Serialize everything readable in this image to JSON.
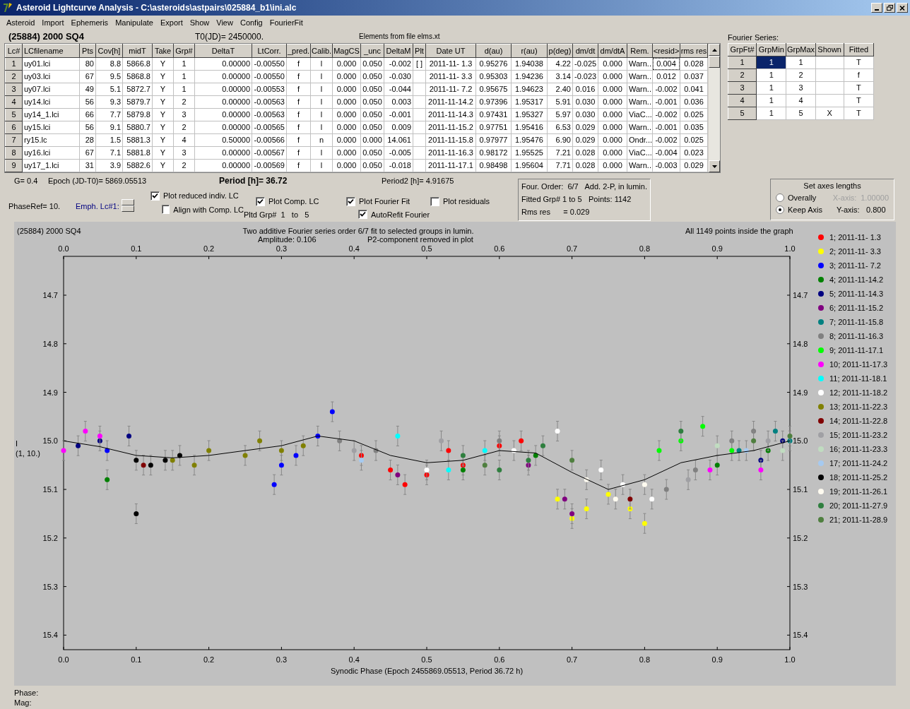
{
  "window": {
    "title": "Asteroid Lightcurve Analysis - C:\\asteroids\\astpairs\\025884_b1\\ini.alc"
  },
  "menu": [
    "Asteroid",
    "Import",
    "Ephemeris",
    "Manipulate",
    "Export",
    "Show",
    "View",
    "Config",
    "FourierFit"
  ],
  "object_name": "(25884) 2000 SQ4",
  "t0": "T0(JD)= 2450000.",
  "elements_note": "Elements from file elms.xt",
  "lc_table": {
    "columns": [
      "Lc#",
      "LCfilename",
      "Pts",
      "Cov[h]",
      "midT",
      "Take",
      "Grp#",
      "DeltaT",
      "LtCorr.",
      "_pred.",
      "Calib.",
      "MagCS",
      "_unc",
      "DeltaM",
      "Plt",
      "Date UT",
      "d(au)",
      "r(au)",
      "p(deg)",
      "dm/dt",
      "dm/dtA",
      "Rem.",
      "<resid>",
      "rms res"
    ],
    "rows": [
      {
        "focused": true,
        "cells": [
          "1",
          "uy01.lci",
          "80",
          "8.8",
          "5866.8",
          "Y",
          "1",
          "0.00000",
          "-0.00550",
          "f",
          "l",
          "0.000",
          "0.050",
          "-0.002",
          "[ ]",
          "2011-11- 1.3",
          "0.95276",
          "1.94038",
          "4.22",
          "-0.025",
          "0.000",
          "Warn..",
          "0.004",
          "0.028"
        ]
      },
      {
        "focused": false,
        "cells": [
          "2",
          "uy03.lci",
          "67",
          "9.5",
          "5868.8",
          "Y",
          "1",
          "0.00000",
          "-0.00550",
          "f",
          "l",
          "0.000",
          "0.050",
          "-0.030",
          null,
          "2011-11- 3.3",
          "0.95303",
          "1.94236",
          "3.14",
          "-0.023",
          "0.000",
          "Warn..",
          "0.012",
          "0.037"
        ]
      },
      {
        "focused": false,
        "cells": [
          "3",
          "uy07.lci",
          "49",
          "5.1",
          "5872.7",
          "Y",
          "1",
          "0.00000",
          "-0.00553",
          "f",
          "l",
          "0.000",
          "0.050",
          "-0.044",
          null,
          "2011-11- 7.2",
          "0.95675",
          "1.94623",
          "2.40",
          "0.016",
          "0.000",
          "Warn..",
          "-0.002",
          "0.041"
        ]
      },
      {
        "focused": false,
        "cells": [
          "4",
          "uy14.lci",
          "56",
          "9.3",
          "5879.7",
          "Y",
          "2",
          "0.00000",
          "-0.00563",
          "f",
          "l",
          "0.000",
          "0.050",
          "0.003",
          null,
          "2011-11-14.2",
          "0.97396",
          "1.95317",
          "5.91",
          "0.030",
          "0.000",
          "Warn..",
          "-0.001",
          "0.036"
        ]
      },
      {
        "focused": false,
        "cells": [
          "5",
          "uy14_1.lci",
          "66",
          "7.7",
          "5879.8",
          "Y",
          "3",
          "0.00000",
          "-0.00563",
          "f",
          "l",
          "0.000",
          "0.050",
          "-0.001",
          null,
          "2011-11-14.3",
          "0.97431",
          "1.95327",
          "5.97",
          "0.030",
          "0.000",
          "ViaC...",
          "-0.002",
          "0.025"
        ]
      },
      {
        "focused": false,
        "cells": [
          "6",
          "uy15.lci",
          "56",
          "9.1",
          "5880.7",
          "Y",
          "2",
          "0.00000",
          "-0.00565",
          "f",
          "l",
          "0.000",
          "0.050",
          "0.009",
          null,
          "2011-11-15.2",
          "0.97751",
          "1.95416",
          "6.53",
          "0.029",
          "0.000",
          "Warn..",
          "-0.001",
          "0.035"
        ]
      },
      {
        "focused": false,
        "cells": [
          "7",
          "ry15.lc",
          "28",
          "1.5",
          "5881.3",
          "Y",
          "4",
          "0.50000",
          "-0.00566",
          "f",
          "n",
          "0.000",
          "0.000",
          "14.061",
          null,
          "2011-11-15.8",
          "0.97977",
          "1.95476",
          "6.90",
          "0.029",
          "0.000",
          "Ondr...",
          "-0.002",
          "0.025"
        ]
      },
      {
        "focused": false,
        "cells": [
          "8",
          "uy16.lci",
          "67",
          "7.1",
          "5881.8",
          "Y",
          "3",
          "0.00000",
          "-0.00567",
          "f",
          "l",
          "0.000",
          "0.050",
          "-0.005",
          null,
          "2011-11-16.3",
          "0.98172",
          "1.95525",
          "7.21",
          "0.028",
          "0.000",
          "ViaC...",
          "-0.004",
          "0.023"
        ]
      },
      {
        "focused": false,
        "cells": [
          "9",
          "uy17_1.lci",
          "31",
          "3.9",
          "5882.6",
          "Y",
          "2",
          "0.00000",
          "-0.00569",
          "f",
          "l",
          "0.000",
          "0.050",
          "-0.018",
          null,
          "2011-11-17.1",
          "0.98498",
          "1.95604",
          "7.71",
          "0.028",
          "0.000",
          "Warn..",
          "-0.003",
          "0.029"
        ]
      }
    ]
  },
  "fourier": {
    "label": "Fourier Series:",
    "columns": [
      "GrpFt#",
      "GrpMin",
      "GrpMax",
      "Shown",
      "Fitted"
    ],
    "shown_mark": "X",
    "rows": [
      {
        "num": "1",
        "grp_min": "1",
        "grp_max": "1",
        "shown": false,
        "fitted": "T",
        "selected": true
      },
      {
        "num": "2",
        "grp_min": "1",
        "grp_max": "2",
        "shown": false,
        "fitted": "f",
        "selected": false
      },
      {
        "num": "3",
        "grp_min": "1",
        "grp_max": "3",
        "shown": false,
        "fitted": "T",
        "selected": false
      },
      {
        "num": "4",
        "grp_min": "1",
        "grp_max": "4",
        "shown": false,
        "fitted": "T",
        "selected": false
      },
      {
        "num": "5",
        "grp_min": "1",
        "grp_max": "5",
        "shown": true,
        "fitted": "T",
        "selected": false
      }
    ]
  },
  "params": {
    "g": "G= 0.4",
    "epoch": "Epoch (JD-T0)= 5869.05513",
    "period": "Period [h]= 36.72",
    "period2": "Period2 [h]= 4.91675",
    "phase_ref": "PhaseRef= 10.",
    "emph": "Emph. Lc#1:",
    "pltd_grp": "Pltd Grp#  1   to   5"
  },
  "options": [
    {
      "label": "Plot reduced indiv. LC",
      "checked": true
    },
    {
      "label": "Align with Comp. LC",
      "checked": false
    },
    {
      "label": "Plot Comp. LC",
      "checked": true
    },
    {
      "label": "Plot Fourier Fit",
      "checked": true
    },
    {
      "label": "AutoRefit Fourier",
      "checked": true
    },
    {
      "label": "Plot residuals",
      "checked": false
    }
  ],
  "fit_info": [
    [
      "Four. Order:  6/7",
      "Add. 2-P, in lumin."
    ],
    [
      "Fitted Grp# 1 to 5",
      "Points: 1142"
    ],
    [
      "Rms res      = 0.029"
    ]
  ],
  "axes_group": {
    "title": "Set axes lengths",
    "modes": [
      {
        "label": "Overally",
        "selected": false
      },
      {
        "label": "Keep Axis",
        "selected": true
      }
    ],
    "axes": [
      {
        "label": "X-axis:",
        "value": "1.00000",
        "disabled": true
      },
      {
        "label": "Y-axis:",
        "value": "0.800",
        "disabled": false
      }
    ]
  },
  "chart": {
    "chart_data": {
      "type": "scatter",
      "title": "(25884) 2000 SQ4",
      "xlabel": "Synodic Phase (Epoch 2455869.05513, Period 36.72 h)",
      "xlim": [
        0,
        1
      ],
      "ylim": [
        15.43,
        14.62
      ],
      "xticks": [
        {
          "value": 0,
          "label": "0.0"
        },
        {
          "value": 0.1,
          "label": "0.1"
        },
        {
          "value": 0.2,
          "label": "0.2"
        },
        {
          "value": 0.3,
          "label": "0.3"
        },
        {
          "value": 0.4,
          "label": "0.4"
        },
        {
          "value": 0.5,
          "label": "0.5"
        },
        {
          "value": 0.6,
          "label": "0.6"
        },
        {
          "value": 0.7,
          "label": "0.7"
        },
        {
          "value": 0.8,
          "label": "0.8"
        },
        {
          "value": 0.9,
          "label": "0.9"
        },
        {
          "value": 1,
          "label": "1.0"
        }
      ],
      "yticks": [
        {
          "value": 14.7,
          "label": "14.7"
        },
        {
          "value": 14.8,
          "label": "14.8"
        },
        {
          "value": 14.9,
          "label": "14.9"
        },
        {
          "value": 15,
          "label": "15.0"
        },
        {
          "value": 15.1,
          "label": "15.1"
        },
        {
          "value": 15.2,
          "label": "15.2"
        },
        {
          "value": 15.3,
          "label": "15.3"
        },
        {
          "value": 15.4,
          "label": "15.4"
        }
      ],
      "annotations": [
        "I",
        "(1, 10.)",
        "Two additive Fourier series order 6/7 fit to selected groups in lumin.",
        "Amplitude: 0.106",
        "P2-component removed in plot",
        "All 1149 points inside the graph"
      ],
      "series": [
        {
          "type": "line",
          "color": "#000000",
          "x": [
            0,
            0.05,
            0.1,
            0.15,
            0.2,
            0.25,
            0.3,
            0.35,
            0.4,
            0.45,
            0.5,
            0.55,
            0.6,
            0.65,
            0.7,
            0.75,
            0.8,
            0.85,
            0.9,
            0.95,
            1
          ],
          "values": [
            15.0,
            15.012,
            15.03,
            15.035,
            15.03,
            15.02,
            15.01,
            14.99,
            15.0,
            15.03,
            15.045,
            15.04,
            15.02,
            15.025,
            15.065,
            15.1,
            15.08,
            15.045,
            15.03,
            15.02,
            15.0
          ]
        },
        {
          "name": "1; 2011-11- 1.3",
          "color": "#ff0000",
          "x": [
            0.41,
            0.45,
            0.47,
            0.5,
            0.53,
            0.55,
            0.6,
            0.63
          ],
          "values": [
            15.03,
            15.06,
            15.09,
            15.07,
            15.02,
            15.05,
            15.01,
            15.0
          ]
        },
        {
          "name": "2; 2011-11- 3.3",
          "color": "#ffff00",
          "x": [
            0.68,
            0.7,
            0.72,
            0.75,
            0.78,
            0.8
          ],
          "values": [
            15.12,
            15.16,
            15.14,
            15.11,
            15.14,
            15.17
          ]
        },
        {
          "name": "3; 2011-11- 7.2",
          "color": "#0000ff",
          "x": [
            0.06,
            0.29,
            0.3,
            0.32,
            0.35,
            0.37
          ],
          "values": [
            15.02,
            15.09,
            15.05,
            15.03,
            14.99,
            14.94
          ]
        },
        {
          "name": "4; 2011-11-14.2",
          "color": "#008000",
          "x": [
            0.06,
            0.55,
            0.65,
            0.9,
            0.97
          ],
          "values": [
            15.08,
            15.06,
            15.03,
            15.05,
            15.02
          ]
        },
        {
          "name": "5; 2011-11-14.3",
          "color": "#000080",
          "x": [
            0.02,
            0.05,
            0.09,
            0.96,
            0.99
          ],
          "values": [
            15.01,
            15.0,
            14.99,
            15.04,
            15.0
          ]
        },
        {
          "name": "6; 2011-11-15.2",
          "color": "#800080",
          "x": [
            0.46,
            0.64,
            0.69,
            0.7
          ],
          "values": [
            15.07,
            15.05,
            15.12,
            15.15
          ]
        },
        {
          "name": "7; 2011-11-15.8",
          "color": "#008080",
          "x": [
            0.93,
            0.98,
            1.0
          ],
          "values": [
            15.02,
            14.98,
            15.0
          ]
        },
        {
          "name": "8; 2011-11-16.3",
          "color": "#808080",
          "x": [
            0.38,
            0.43,
            0.6,
            0.83,
            0.87,
            0.92,
            0.95
          ],
          "values": [
            15.0,
            15.02,
            15.0,
            15.1,
            15.06,
            15.0,
            14.98
          ]
        },
        {
          "name": "9; 2011-11-17.1",
          "color": "#00ff00",
          "x": [
            0.82,
            0.85,
            0.88,
            0.92
          ],
          "values": [
            15.02,
            15.0,
            14.97,
            15.02
          ]
        },
        {
          "name": "10; 2011-11-17.3",
          "color": "#ff00ff",
          "x": [
            0.0,
            0.03,
            0.05,
            0.89,
            0.96
          ],
          "values": [
            15.02,
            14.98,
            14.99,
            15.06,
            15.06
          ]
        },
        {
          "name": "11; 2011-11-18.1",
          "color": "#00ffff",
          "x": [
            0.46,
            0.53,
            0.58
          ],
          "values": [
            14.99,
            15.06,
            15.02
          ]
        },
        {
          "name": "12; 2011-11-18.2",
          "color": "#ffffff",
          "x": [
            0.5,
            0.62,
            0.68,
            0.74,
            0.77,
            0.81
          ],
          "values": [
            15.06,
            15.02,
            14.98,
            15.06,
            15.09,
            15.12
          ]
        },
        {
          "name": "13; 2011-11-22.3",
          "color": "#808000",
          "x": [
            0.15,
            0.18,
            0.2,
            0.25,
            0.27,
            0.3,
            0.33
          ],
          "values": [
            15.04,
            15.05,
            15.02,
            15.03,
            15.0,
            15.02,
            15.01
          ]
        },
        {
          "name": "14; 2011-11-22.8",
          "color": "#800000",
          "x": [
            0.11,
            0.78
          ],
          "values": [
            15.05,
            15.12
          ]
        },
        {
          "name": "15; 2011-11-23.2",
          "color": "#a0a0a4",
          "x": [
            0.4,
            0.52,
            0.86,
            0.97
          ],
          "values": [
            15.02,
            15.0,
            15.08,
            15.0
          ]
        },
        {
          "name": "16; 2011-11-23.3",
          "color": "#c0dcc0",
          "x": [
            0.9,
            0.99
          ],
          "values": [
            15.01,
            15.02
          ]
        },
        {
          "name": "17; 2011-11-24.2",
          "color": "#a6caf0",
          "x": [
            0.41,
            0.94
          ],
          "values": [
            15.04,
            15.02
          ]
        },
        {
          "name": "18; 2011-11-25.2",
          "color": "#000000",
          "x": [
            0.1,
            0.1,
            0.12,
            0.14,
            0.16
          ],
          "values": [
            15.04,
            15.15,
            15.05,
            15.04,
            15.03
          ]
        },
        {
          "name": "19; 2011-11-26.1",
          "color": "#fffbf0",
          "x": [
            0.72,
            0.76,
            0.8
          ],
          "values": [
            15.08,
            15.12,
            15.09
          ]
        },
        {
          "name": "20; 2011-11-27.9",
          "color": "#2f7f3f",
          "x": [
            0.55,
            0.6,
            0.64,
            0.66,
            0.85
          ],
          "values": [
            15.03,
            15.06,
            15.04,
            15.01,
            14.98
          ]
        },
        {
          "name": "21; 2011-11-28.9",
          "color": "#4f7f3f",
          "x": [
            0.58,
            0.7,
            0.95,
            1.0
          ],
          "values": [
            15.05,
            15.04,
            15.0,
            14.99
          ]
        }
      ]
    }
  },
  "status": [
    "Phase:",
    "Mag:"
  ]
}
